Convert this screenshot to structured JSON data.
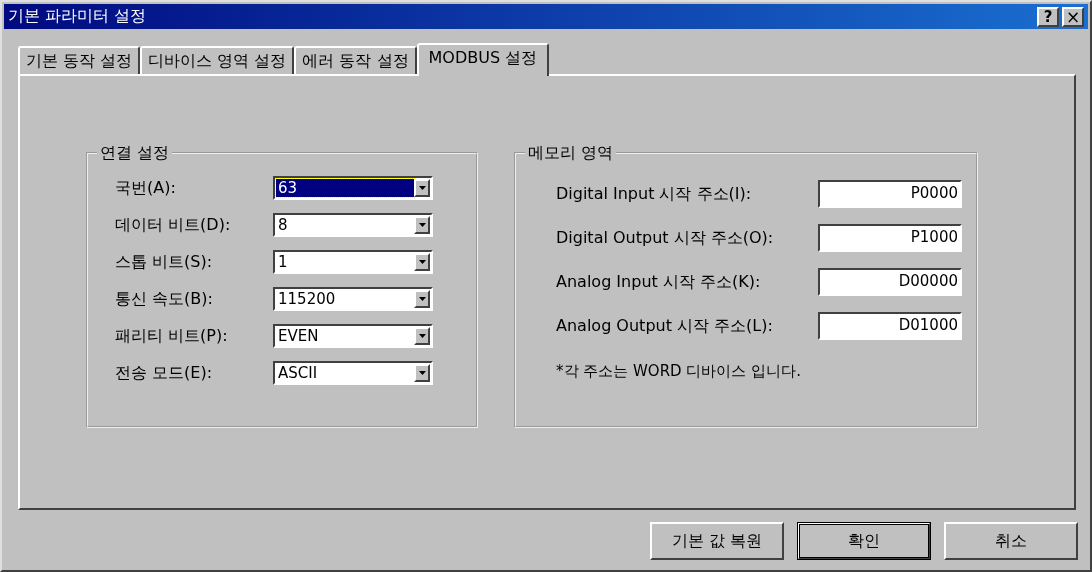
{
  "window": {
    "title": "기본 파라미터 설정",
    "title_buttons": [
      {
        "kind": "help",
        "label": "?"
      },
      {
        "kind": "close",
        "label": "×"
      }
    ]
  },
  "tabs": [
    {
      "label": "기본 동작 설정",
      "selected": false
    },
    {
      "label": "디바이스 영역 설정",
      "selected": false
    },
    {
      "label": "에러 동작 설정",
      "selected": false
    },
    {
      "label": "MODBUS 설정",
      "selected": true
    }
  ],
  "connection_group": {
    "title": "연결 설정",
    "fields": [
      {
        "label": "국번(A):",
        "value": "63",
        "focused": true
      },
      {
        "label": "데이터 비트(D):",
        "value": "8",
        "focused": false
      },
      {
        "label": "스톱 비트(S):",
        "value": "1",
        "focused": false
      },
      {
        "label": "통신 속도(B):",
        "value": "115200",
        "focused": false
      },
      {
        "label": "패리티 비트(P):",
        "value": "EVEN",
        "focused": false
      },
      {
        "label": "전송 모드(E):",
        "value": "ASCII",
        "focused": false
      }
    ]
  },
  "memory_group": {
    "title": "메모리 영역",
    "fields": [
      {
        "label": "Digital Input 시작 주소(I):",
        "value": "P0000"
      },
      {
        "label": "Digital Output 시작 주소(O):",
        "value": "P1000"
      },
      {
        "label": "Analog Input 시작 주소(K):",
        "value": "D00000"
      },
      {
        "label": "Analog Output 시작 주소(L):",
        "value": "D01000"
      }
    ],
    "note": "*각 주소는 WORD 디바이스 입니다."
  },
  "buttons": [
    {
      "label": "기본 값 복원",
      "default": false
    },
    {
      "label": "확인",
      "default": true
    },
    {
      "label": "취소",
      "default": false
    }
  ]
}
